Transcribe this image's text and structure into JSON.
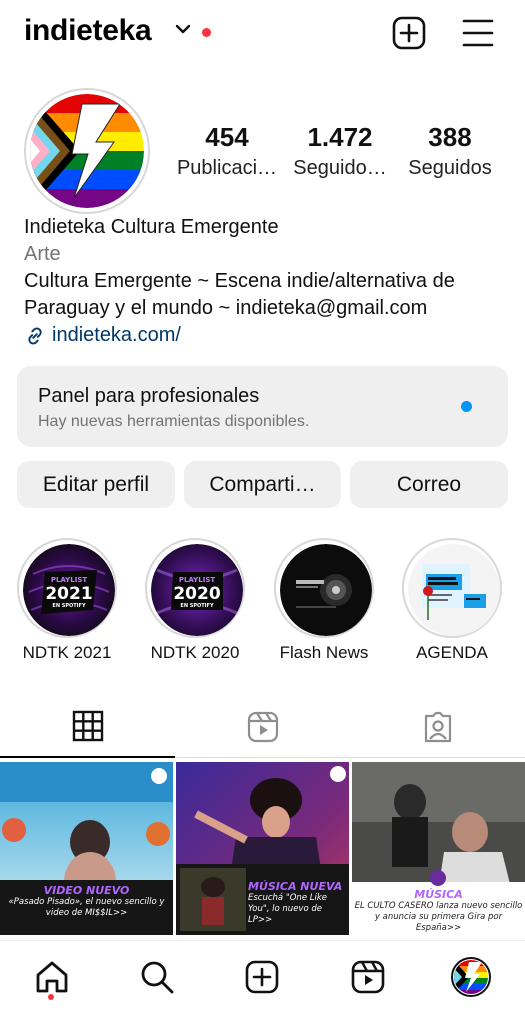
{
  "header": {
    "username": "indieteka",
    "icons": [
      "chevron-down-icon",
      "notification-dot",
      "new-post-icon",
      "menu-icon"
    ],
    "accent": "#ff3040"
  },
  "profile": {
    "stats": [
      {
        "value": "454",
        "label": "Publicaci…"
      },
      {
        "value": "1.472",
        "label": "Seguido…"
      },
      {
        "value": "388",
        "label": "Seguidos"
      }
    ],
    "name": "Indieteka Cultura Emergente",
    "category": "Arte",
    "bio": "Cultura Emergente ~ Escena indie/alternativa de Paraguay y el mundo ~ indieteka@gmail.com",
    "link": "indieteka.com/",
    "link_color": "#00376b"
  },
  "panel": {
    "title": "Panel para profesionales",
    "subtitle": "Hay nuevas herramientas disponibles.",
    "dot_color": "#0095f6"
  },
  "buttons": {
    "edit": "Editar perfil",
    "share": "Comparti…",
    "email": "Correo"
  },
  "highlights": [
    {
      "label": "NDTK 2021",
      "badge_top": "PLAYLIST",
      "badge_year": "2021",
      "badge_sub": "EN SPOTIFY"
    },
    {
      "label": "NDTK 2020",
      "badge_top": "PLAYLIST",
      "badge_year": "2020",
      "badge_sub": "EN SPOTIFY"
    },
    {
      "label": "Flash News"
    },
    {
      "label": "AGENDA"
    }
  ],
  "tabs": [
    "grid-icon",
    "reels-icon",
    "tagged-icon"
  ],
  "posts": [
    {
      "heading": "VIDEO NUEVO",
      "text": "«Pasado Pisado», el nuevo sencillo y video de MI$$IL>>"
    },
    {
      "heading": "MÚSICA NUEVA",
      "text": "Escuchá \"One Like You\", lo nuevo de LP>>"
    },
    {
      "heading": "MÚSICA",
      "text": "EL CULTO CASERO lanza nuevo sencillo y anuncia su primera Gira por España>>"
    }
  ],
  "bottom_nav": [
    "home-icon",
    "search-icon",
    "create-icon",
    "reels-icon",
    "profile-avatar"
  ]
}
